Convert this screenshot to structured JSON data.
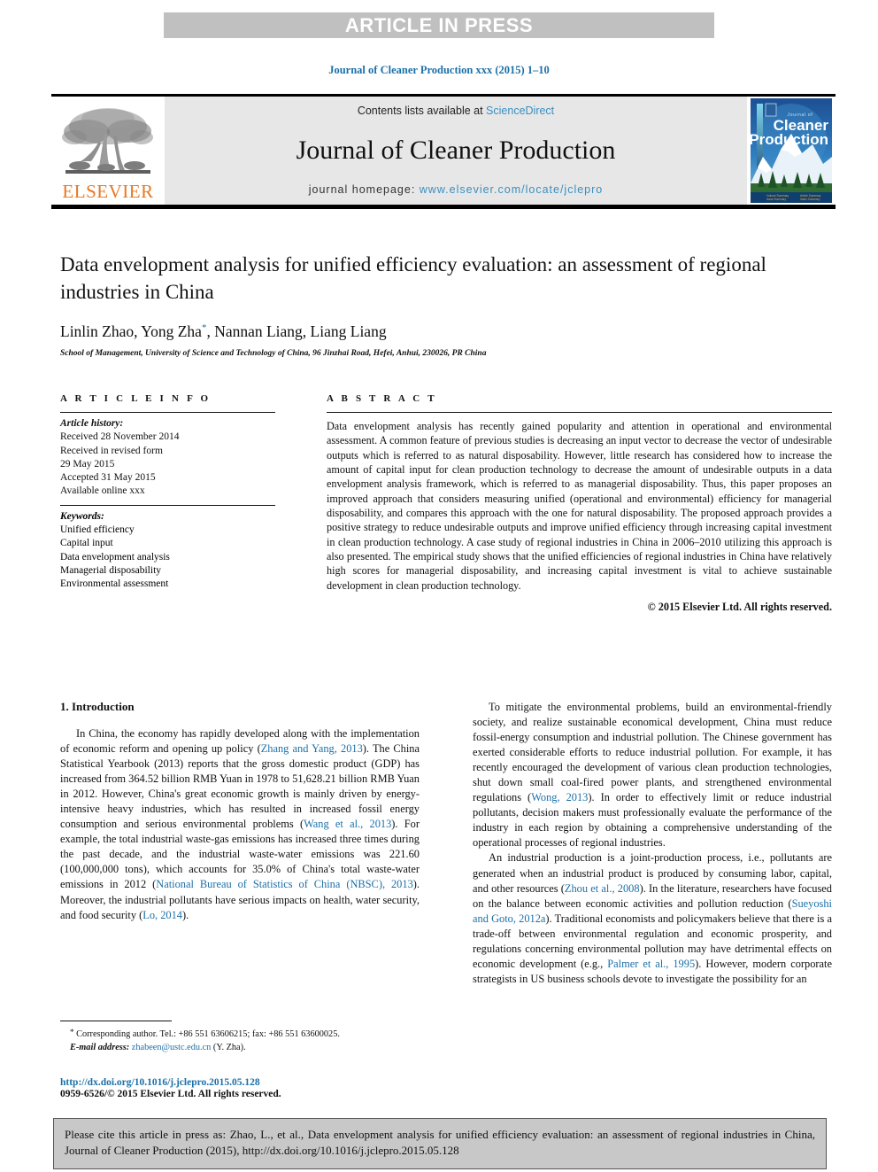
{
  "header": {
    "article_in_press": "ARTICLE IN PRESS",
    "journal_ref": "Journal of Cleaner Production xxx (2015) 1–10"
  },
  "masthead": {
    "elsevier_wordmark": "ELSEVIER",
    "contents_prefix": "Contents lists available at ",
    "contents_link": "ScienceDirect",
    "journal_title": "Journal of Cleaner Production",
    "homepage_prefix": "journal homepage: ",
    "homepage_url": "www.elsevier.com/locate/jclepro",
    "cover_line1": "Journal of",
    "cover_line2": "Cleaner",
    "cover_line3": "Production"
  },
  "article": {
    "title": "Data envelopment analysis for unified efficiency evaluation: an assessment of regional industries in China",
    "authors_part1": "Linlin Zhao, Yong Zha",
    "authors_star": "*",
    "authors_part2": ", Nannan Liang, Liang Liang",
    "affiliation": "School of Management, University of Science and Technology of China, 96 Jinzhai Road, Hefei, Anhui, 230026, PR China"
  },
  "info": {
    "label": "A R T I C L E   I N F O",
    "history_header": "Article history:",
    "history": [
      "Received 28 November 2014",
      "Received in revised form",
      "29 May 2015",
      "Accepted 31 May 2015",
      "Available online xxx"
    ],
    "keywords_header": "Keywords:",
    "keywords": [
      "Unified efficiency",
      "Capital input",
      "Data envelopment analysis",
      "Managerial disposability",
      "Environmental assessment"
    ]
  },
  "abstract": {
    "label": "A B S T R A C T",
    "text": "Data envelopment analysis has recently gained popularity and attention in operational and environmental assessment. A common feature of previous studies is decreasing an input vector to decrease the vector of undesirable outputs which is referred to as natural disposability. However, little research has considered how to increase the amount of capital input for clean production technology to decrease the amount of undesirable outputs in a data envelopment analysis framework, which is referred to as managerial disposability. Thus, this paper proposes an improved approach that considers measuring unified (operational and environmental) efficiency for managerial disposability, and compares this approach with the one for natural disposability. The proposed approach provides a positive strategy to reduce undesirable outputs and improve unified efficiency through increasing capital investment in clean production technology. A case study of regional industries in China in 2006–2010 utilizing this approach is also presented. The empirical study shows that the unified efficiencies of regional industries in China have relatively high scores for managerial disposability, and increasing capital investment is vital to achieve sustainable development in clean production technology.",
    "copyright": "© 2015 Elsevier Ltd. All rights reserved."
  },
  "body": {
    "section_heading": "1. Introduction",
    "left_p1_a": "In China, the economy has rapidly developed along with the implementation of economic reform and opening up policy (",
    "left_p1_ref1": "Zhang and Yang, 2013",
    "left_p1_b": "). The China Statistical Yearbook (2013) reports that the gross domestic product (GDP) has increased from 364.52 billion RMB Yuan in 1978 to 51,628.21 billion RMB Yuan in 2012. However, China's great economic growth is mainly driven by energy-intensive heavy industries, which has resulted in increased fossil energy consumption and serious environmental problems (",
    "left_p1_ref2": "Wang et al., 2013",
    "left_p1_c": "). For example, the total industrial waste-gas emissions has increased three times during the past decade, and the industrial waste-water emissions was 221.60 (100,000,000 tons), which accounts for 35.0% of China's total waste-water emissions in 2012 (",
    "left_p1_ref3": "National Bureau of Statistics of China (NBSC), 2013",
    "left_p1_d": "). Moreover, the industrial pollutants have serious impacts on health, water security, and food security (",
    "left_p1_ref4": "Lo, 2014",
    "left_p1_e": ").",
    "right_p1_a": "To mitigate the environmental problems, build an environmental-friendly society, and realize sustainable economical development, China must reduce fossil-energy consumption and industrial pollution. The Chinese government has exerted considerable efforts to reduce industrial pollution. For example, it has recently encouraged the development of various clean production technologies, shut down small coal-fired power plants, and strengthened environmental regulations (",
    "right_p1_ref1": "Wong, 2013",
    "right_p1_b": "). In order to effectively limit or reduce industrial pollutants, decision makers must professionally evaluate the performance of the industry in each region by obtaining a comprehensive understanding of the operational processes of regional industries.",
    "right_p2_a": "An industrial production is a joint-production process, i.e., pollutants are generated when an industrial product is produced by consuming labor, capital, and other resources (",
    "right_p2_ref1": "Zhou et al., 2008",
    "right_p2_b": "). In the literature, researchers have focused on the balance between economic activities and pollution reduction (",
    "right_p2_ref2": "Sueyoshi and Goto, 2012a",
    "right_p2_c": "). Traditional economists and policymakers believe that there is a trade-off between environmental regulation and economic prosperity, and regulations concerning environmental pollution may have detrimental effects on economic development (e.g., ",
    "right_p2_ref3": "Palmer et al., 1995",
    "right_p2_d": "). However, modern corporate strategists in US business schools devote to investigate the possibility for an"
  },
  "footnote": {
    "star": "*",
    "corresponding": " Corresponding author. Tel.: +86 551 63606215; fax: +86 551 63600025.",
    "email_label": "E-mail address:",
    "email": "zhabeen@ustc.edu.cn",
    "email_suffix": " (Y. Zha).",
    "doi": "http://dx.doi.org/10.1016/j.jclepro.2015.05.128",
    "issn": "0959-6526/© 2015 Elsevier Ltd. All rights reserved."
  },
  "cite_box": {
    "text": "Please cite this article in press as: Zhao, L., et al., Data envelopment analysis for unified efficiency evaluation: an assessment of regional industries in China, Journal of Cleaner Production (2015), http://dx.doi.org/10.1016/j.jclepro.2015.05.128"
  },
  "colors": {
    "link_blue": "#1b70a8",
    "banner_gray": "#e7e7e7",
    "aip_gray": "#c0c0c0",
    "elsevier_orange": "#e87722",
    "cite_gray": "#c8c8c8"
  }
}
